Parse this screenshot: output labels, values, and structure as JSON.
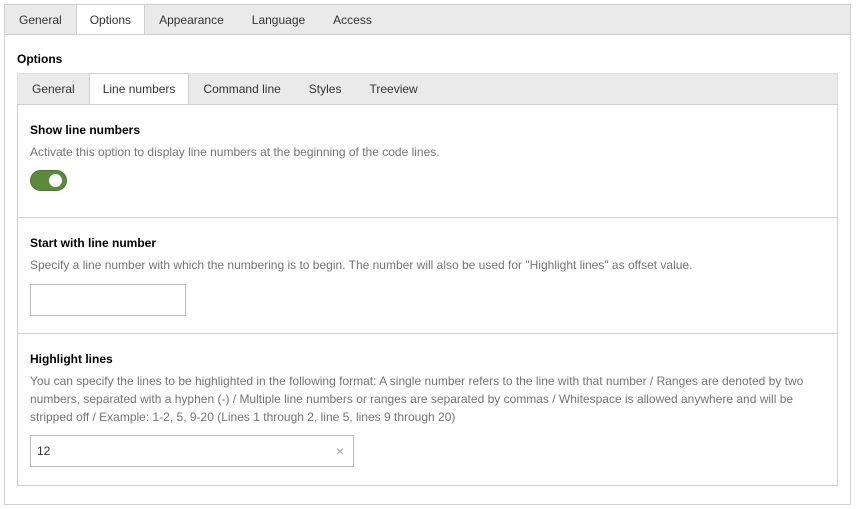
{
  "top_tabs": [
    "General",
    "Options",
    "Appearance",
    "Language",
    "Access"
  ],
  "top_active": "Options",
  "section_title": "Options",
  "inner_tabs": [
    "General",
    "Line numbers",
    "Command line",
    "Styles",
    "Treeview"
  ],
  "inner_active": "Line numbers",
  "fields": {
    "show_line_numbers": {
      "label": "Show line numbers",
      "description": "Activate this option to display line numbers at the beginning of the code lines.",
      "enabled": true
    },
    "start_line": {
      "label": "Start with line number",
      "description": "Specify a line number with which the numbering is to begin. The number will also be used for \"Highlight lines\" as offset value.",
      "value": ""
    },
    "highlight_lines": {
      "label": "Highlight lines",
      "description": "You can specify the lines to be highlighted in the following format: A single number refers to the line with that number / Ranges are denoted by two numbers, separated with a hyphen (-) / Multiple line numbers or ranges are separated by commas / Whitespace is allowed anywhere and will be stripped off / Example: 1-2, 5, 9-20 (Lines 1 through 2, line 5, lines 9 through 20)",
      "value": "12",
      "clear_icon": "×"
    }
  },
  "colors": {
    "toggle_on": "#5b8a3b",
    "tab_bar": "#eaeaea",
    "border": "#cfcfcf"
  }
}
